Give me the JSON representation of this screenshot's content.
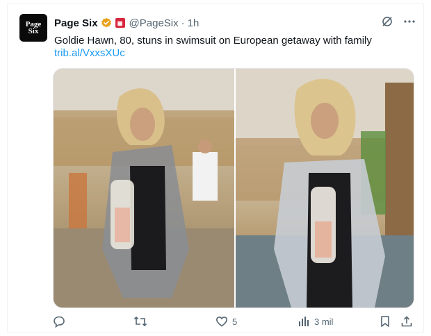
{
  "tweet": {
    "avatar_text_line1": "Page",
    "avatar_text_line2": "Six",
    "author_name": "Page Six",
    "handle": "@PageSix",
    "separator": "·",
    "time": "1h",
    "text": "Goldie Hawn, 80, stuns in swimsuit on European getaway with family",
    "link": "trib.al/VxxsXUc"
  },
  "actions": {
    "likes": "5",
    "views": "3 mil"
  },
  "colors": {
    "accent": "#1d9bf0",
    "verified": "#e8a21a",
    "secondary_text": "#536471"
  },
  "icons": [
    "verified-badge-icon",
    "affiliate-badge-icon",
    "grok-icon",
    "more-icon",
    "reply-icon",
    "retweet-icon",
    "like-icon",
    "views-icon",
    "bookmark-icon",
    "share-icon"
  ]
}
